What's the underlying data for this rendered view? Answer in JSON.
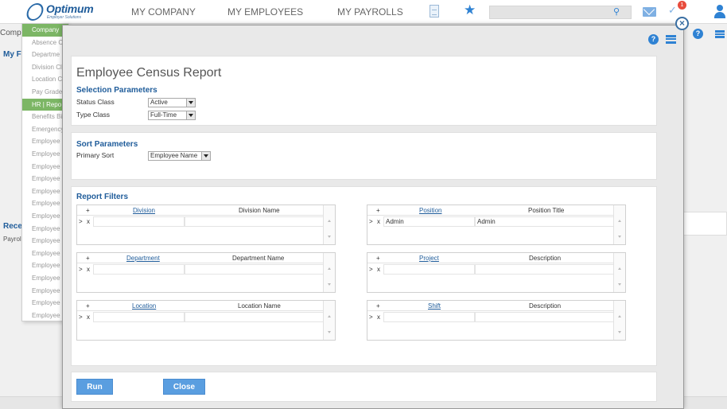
{
  "topbar": {
    "logo_main": "Optimum",
    "logo_sub": "Employer Solutions",
    "nav": [
      "MY COMPANY",
      "MY EMPLOYEES",
      "MY PAYROLLS"
    ],
    "notification_count": "1"
  },
  "background": {
    "title": "Compa",
    "heading": "My Fa",
    "recent": "Recer",
    "recent_item": "Payrol",
    "menu_items": [
      "Company",
      "Absence C",
      "Departme",
      "Division Cl",
      "Location C",
      "Pay Grade",
      "HR | Repo",
      "Benefits Bi",
      "Emergency",
      "Employee",
      "Employee",
      "Employee",
      "Employee",
      "Employee",
      "Employee",
      "Employee",
      "Employee",
      "Employee",
      "Employee",
      "Employee",
      "Employee",
      "Employee",
      "Employee",
      "Employee"
    ],
    "active_menu_indices": [
      0,
      6
    ]
  },
  "report": {
    "title": "Employee Census Report",
    "selection": {
      "heading": "Selection Parameters",
      "status_label": "Status Class",
      "status_value": "Active",
      "type_label": "Type Class",
      "type_value": "Full-Time"
    },
    "sort": {
      "heading": "Sort Parameters",
      "primary_label": "Primary Sort",
      "primary_value": "Employee Name"
    },
    "filters": {
      "heading": "Report Filters",
      "grids": [
        {
          "col1": "Division",
          "col2": "Division Name",
          "val1": "",
          "val2": ""
        },
        {
          "col1": "Position",
          "col2": "Position Title",
          "val1": "Admin",
          "val2": "Admin"
        },
        {
          "col1": "Department",
          "col2": "Department Name",
          "val1": "",
          "val2": ""
        },
        {
          "col1": "Project",
          "col2": "Description",
          "val1": "",
          "val2": ""
        },
        {
          "col1": "Location",
          "col2": "Location Name",
          "val1": "",
          "val2": ""
        },
        {
          "col1": "Shift",
          "col2": "Description",
          "val1": "",
          "val2": ""
        }
      ],
      "add_symbol": "+",
      "expand_symbol": ">",
      "delete_symbol": "x"
    },
    "actions": {
      "run": "Run",
      "close": "Close"
    }
  },
  "colors": {
    "brand_blue": "#1f5c9a",
    "button_blue": "#5a9ee0",
    "menu_active_green": "#7cb665",
    "badge_red": "#e84c3d"
  }
}
